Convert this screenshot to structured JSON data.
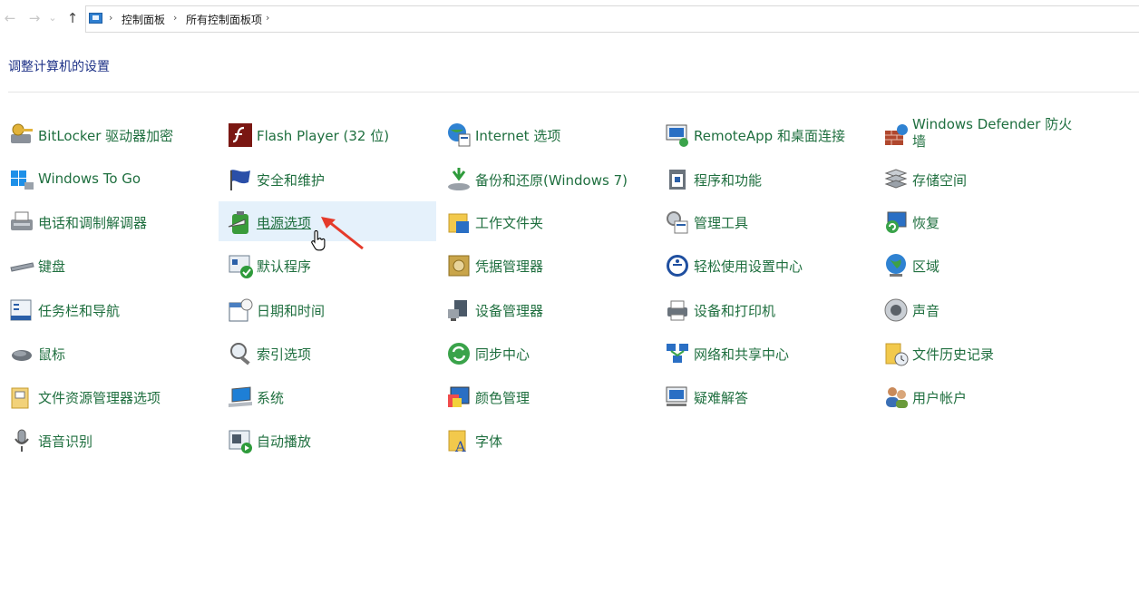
{
  "nav": {
    "back": "←",
    "forward": "→",
    "recent": "⌄",
    "up": "↑"
  },
  "breadcrumb": [
    "控制面板",
    "所有控制面板项"
  ],
  "heading": "调整计算机的设置",
  "items": [
    {
      "label": "BitLocker 驱动器加密",
      "icon": "key-drive-icon",
      "col": 0,
      "row": 0
    },
    {
      "label": "Windows To Go",
      "icon": "windows-usb-icon",
      "col": 0,
      "row": 1
    },
    {
      "label": "电话和调制解调器",
      "icon": "fax-icon",
      "col": 0,
      "row": 2
    },
    {
      "label": "键盘",
      "icon": "keyboard-icon",
      "col": 0,
      "row": 3
    },
    {
      "label": "任务栏和导航",
      "icon": "taskbar-icon",
      "col": 0,
      "row": 4
    },
    {
      "label": "鼠标",
      "icon": "mouse-icon",
      "col": 0,
      "row": 5
    },
    {
      "label": "文件资源管理器选项",
      "icon": "folder-options-icon",
      "col": 0,
      "row": 6
    },
    {
      "label": "语音识别",
      "icon": "microphone-icon",
      "col": 0,
      "row": 7
    },
    {
      "label": "Flash Player (32 位)",
      "icon": "flash-icon",
      "col": 1,
      "row": 0
    },
    {
      "label": "安全和维护",
      "icon": "flag-icon",
      "col": 1,
      "row": 1
    },
    {
      "label": "电源选项",
      "icon": "battery-icon",
      "col": 1,
      "row": 2,
      "hover": true
    },
    {
      "label": "默认程序",
      "icon": "default-programs-icon",
      "col": 1,
      "row": 3
    },
    {
      "label": "日期和时间",
      "icon": "calendar-clock-icon",
      "col": 1,
      "row": 4
    },
    {
      "label": "索引选项",
      "icon": "magnifier-icon",
      "col": 1,
      "row": 5
    },
    {
      "label": "系统",
      "icon": "laptop-icon",
      "col": 1,
      "row": 6
    },
    {
      "label": "自动播放",
      "icon": "autoplay-icon",
      "col": 1,
      "row": 7
    },
    {
      "label": "Internet 选项",
      "icon": "globe-options-icon",
      "col": 2,
      "row": 0
    },
    {
      "label": "备份和还原(Windows 7)",
      "icon": "backup-icon",
      "col": 2,
      "row": 1
    },
    {
      "label": "工作文件夹",
      "icon": "work-folders-icon",
      "col": 2,
      "row": 2
    },
    {
      "label": "凭据管理器",
      "icon": "credential-safe-icon",
      "col": 2,
      "row": 3
    },
    {
      "label": "设备管理器",
      "icon": "device-manager-icon",
      "col": 2,
      "row": 4
    },
    {
      "label": "同步中心",
      "icon": "sync-icon",
      "col": 2,
      "row": 5
    },
    {
      "label": "颜色管理",
      "icon": "color-management-icon",
      "col": 2,
      "row": 6
    },
    {
      "label": "字体",
      "icon": "font-folder-icon",
      "col": 2,
      "row": 7
    },
    {
      "label": "RemoteApp 和桌面连接",
      "icon": "remote-desktop-icon",
      "col": 3,
      "row": 0
    },
    {
      "label": "程序和功能",
      "icon": "programs-icon",
      "col": 3,
      "row": 1
    },
    {
      "label": "管理工具",
      "icon": "admin-tools-icon",
      "col": 3,
      "row": 2
    },
    {
      "label": "轻松使用设置中心",
      "icon": "ease-of-access-icon",
      "col": 3,
      "row": 3
    },
    {
      "label": "设备和打印机",
      "icon": "printer-icon",
      "col": 3,
      "row": 4
    },
    {
      "label": "网络和共享中心",
      "icon": "network-icon",
      "col": 3,
      "row": 5
    },
    {
      "label": "疑难解答",
      "icon": "troubleshoot-icon",
      "col": 3,
      "row": 6
    },
    {
      "label": "Windows Defender 防火墙",
      "icon": "firewall-icon",
      "col": 4,
      "row": 0,
      "twoLine": true
    },
    {
      "label": "存储空间",
      "icon": "storage-icon",
      "col": 4,
      "row": 1
    },
    {
      "label": "恢复",
      "icon": "recovery-icon",
      "col": 4,
      "row": 2
    },
    {
      "label": "区域",
      "icon": "region-globe-icon",
      "col": 4,
      "row": 3
    },
    {
      "label": "声音",
      "icon": "speaker-icon",
      "col": 4,
      "row": 4
    },
    {
      "label": "文件历史记录",
      "icon": "file-history-icon",
      "col": 4,
      "row": 5
    },
    {
      "label": "用户帐户",
      "icon": "users-icon",
      "col": 4,
      "row": 6
    }
  ]
}
